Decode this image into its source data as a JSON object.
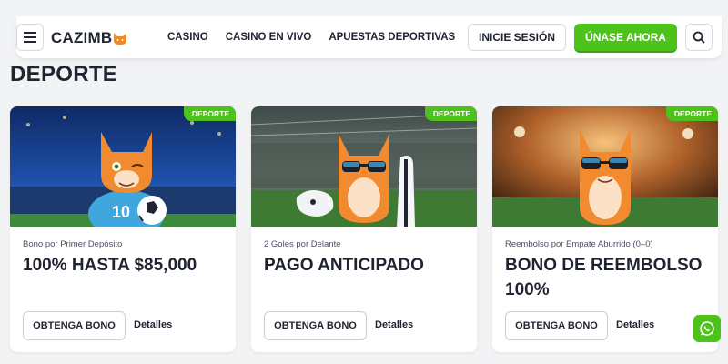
{
  "header": {
    "logo_text": "CAZIMB",
    "nav": [
      "CASINO",
      "CASINO EN VIVO",
      "APUESTAS DEPORTIVAS"
    ],
    "login_label": "INICIE SESIÓN",
    "join_label": "ÚNASE AHORA",
    "icons": {
      "menu": "hamburger-menu-icon",
      "search": "search-icon",
      "logo": "cat-head-icon"
    }
  },
  "section": {
    "title": "DEPORTE"
  },
  "cards": [
    {
      "tag": "DEPORTE",
      "subtitle": "Bono por Primer Depósito",
      "title": "100% HASTA $85,000",
      "button": "OBTENGA BONO",
      "link": "Detalles",
      "image": "cat-soccer-player"
    },
    {
      "tag": "DEPORTE",
      "subtitle": "2 Goles por Delante",
      "title": "PAGO ANTICIPADO",
      "button": "OBTENGA BONO",
      "link": "Detalles",
      "image": "cat-gamer-sunglasses"
    },
    {
      "tag": "DEPORTE",
      "subtitle": "Reembolso por Empate Aburrido (0–0)",
      "title": "BONO DE REEMBOLSO 100%",
      "button": "OBTENGA BONO",
      "link": "Detalles",
      "image": "cat-sunglasses-stadium"
    }
  ],
  "floating": {
    "icon": "whatsapp-icon"
  },
  "colors": {
    "accent": "#4cc21b",
    "text": "#1f2430",
    "background": "#f2f3f5"
  }
}
